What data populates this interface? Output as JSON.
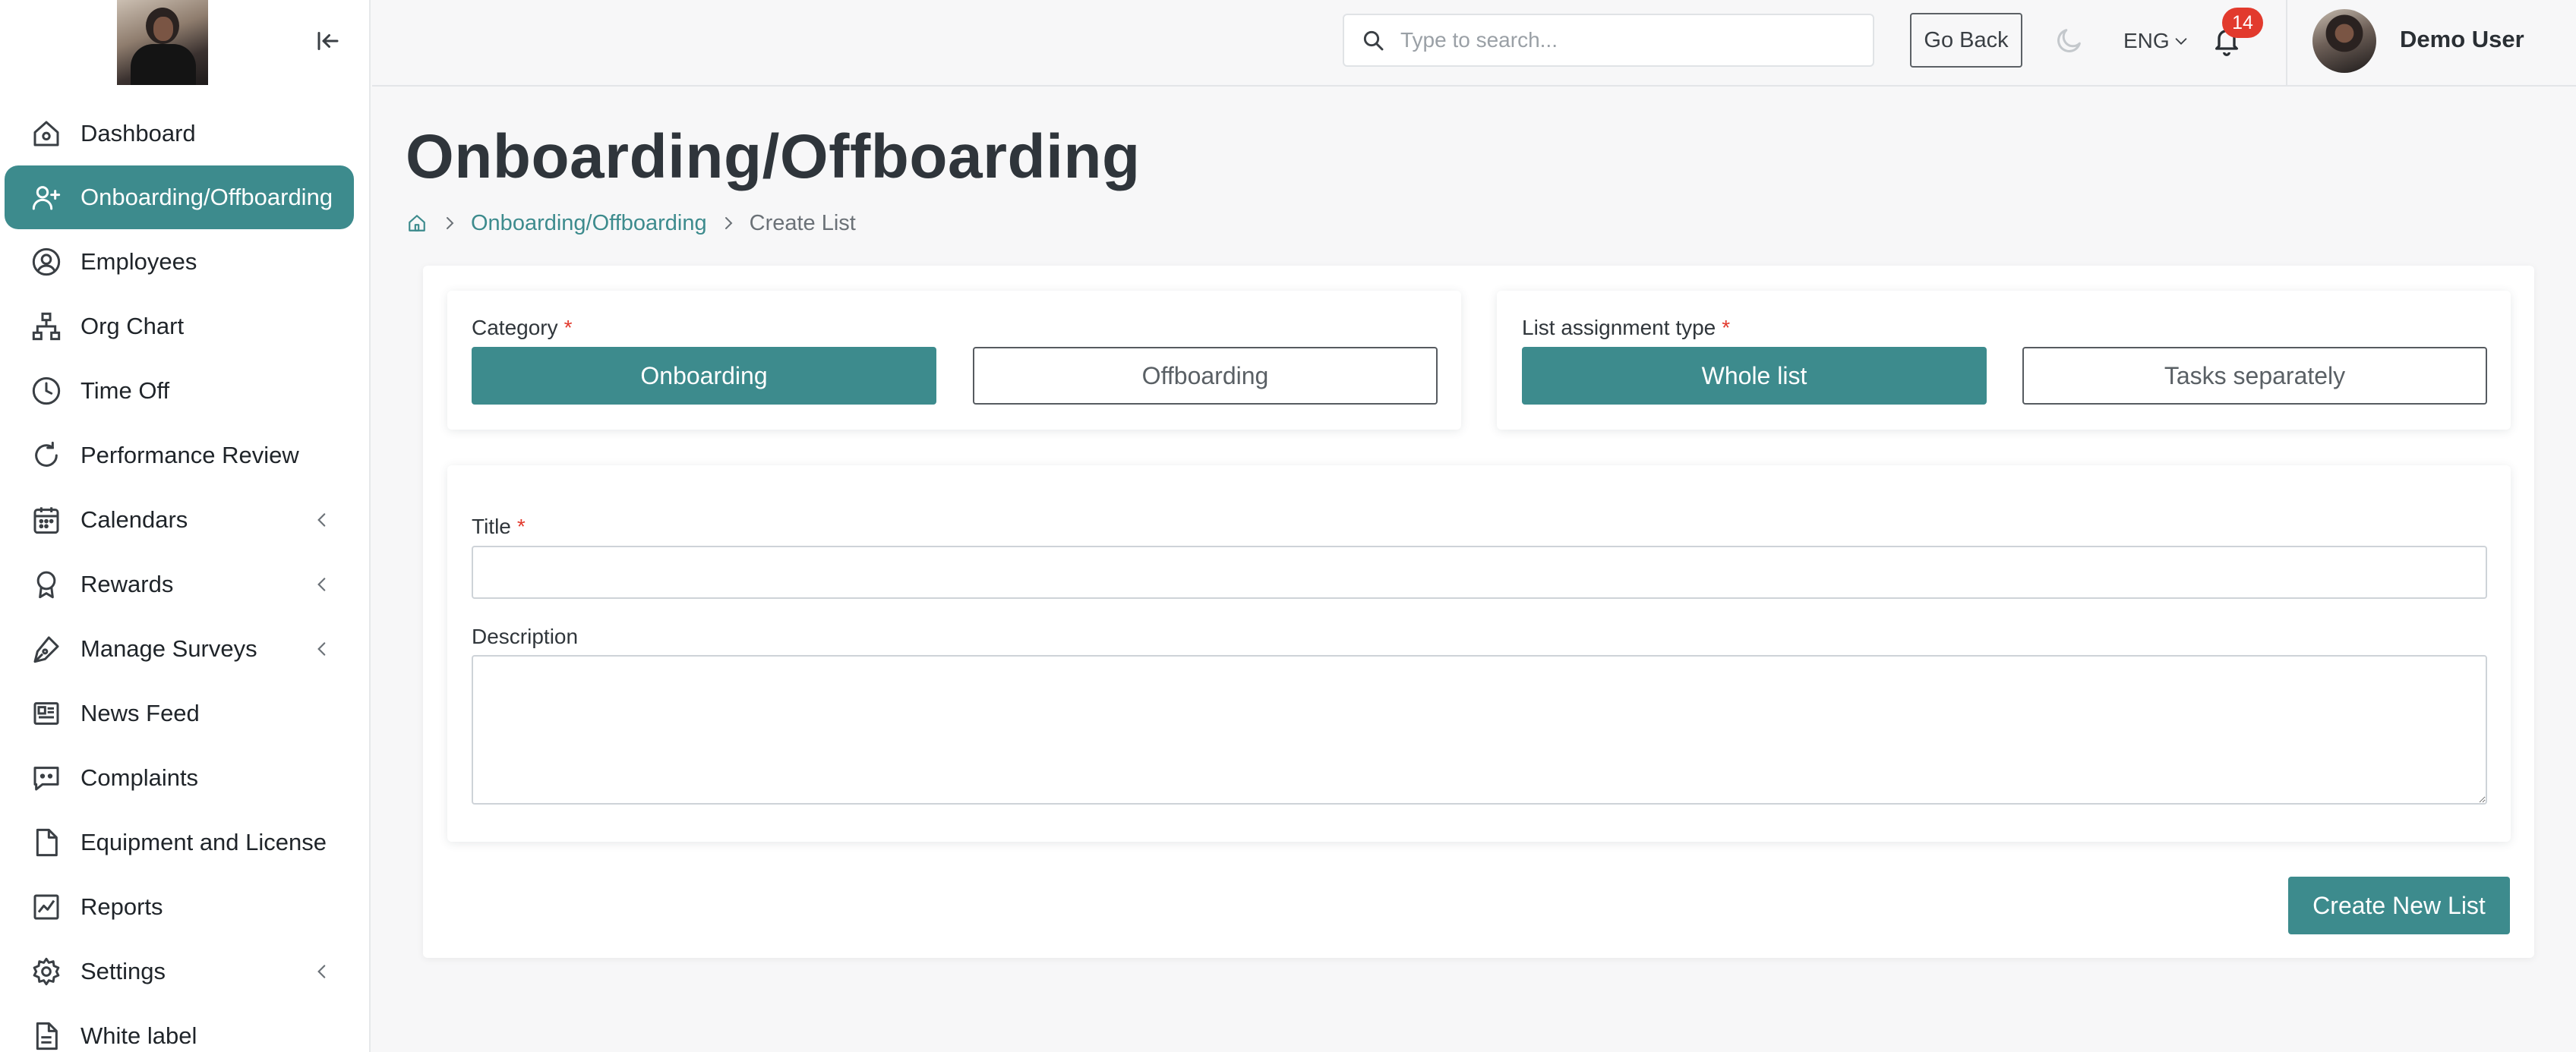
{
  "user": {
    "name": "Demo User"
  },
  "sidebar": {
    "items": [
      {
        "label": "Dashboard",
        "icon": "home-icon",
        "active": false,
        "expandable": false
      },
      {
        "label": "Onboarding/Offboarding",
        "icon": "user-plus-icon",
        "active": true,
        "expandable": false
      },
      {
        "label": "Employees",
        "icon": "user-circle-icon",
        "active": false,
        "expandable": false
      },
      {
        "label": "Org Chart",
        "icon": "org-chart-icon",
        "active": false,
        "expandable": false
      },
      {
        "label": "Time Off",
        "icon": "clock-icon",
        "active": false,
        "expandable": false
      },
      {
        "label": "Performance Review",
        "icon": "refresh-icon",
        "active": false,
        "expandable": false
      },
      {
        "label": "Calendars",
        "icon": "calendar-icon",
        "active": false,
        "expandable": true
      },
      {
        "label": "Rewards",
        "icon": "award-icon",
        "active": false,
        "expandable": true
      },
      {
        "label": "Manage Surveys",
        "icon": "pen-icon",
        "active": false,
        "expandable": true
      },
      {
        "label": "News Feed",
        "icon": "newspaper-icon",
        "active": false,
        "expandable": false
      },
      {
        "label": "Complaints",
        "icon": "message-icon",
        "active": false,
        "expandable": false
      },
      {
        "label": "Equipment and License",
        "icon": "file-icon",
        "active": false,
        "expandable": false
      },
      {
        "label": "Reports",
        "icon": "chart-icon",
        "active": false,
        "expandable": false
      },
      {
        "label": "Settings",
        "icon": "gear-icon",
        "active": false,
        "expandable": true
      },
      {
        "label": "White label",
        "icon": "document-icon",
        "active": false,
        "expandable": false
      }
    ]
  },
  "header": {
    "search_placeholder": "Type to search...",
    "search_value": "",
    "go_back_label": "Go Back",
    "language": "ENG",
    "notification_count": "14"
  },
  "page": {
    "title": "Onboarding/Offboarding",
    "breadcrumb": {
      "parent": "Onboarding/Offboarding",
      "current": "Create List"
    }
  },
  "form": {
    "category": {
      "label": "Category",
      "required_mark": "*",
      "options": [
        "Onboarding",
        "Offboarding"
      ],
      "selected": "Onboarding"
    },
    "assignment": {
      "label": "List assignment type",
      "required_mark": "*",
      "options": [
        "Whole list",
        "Tasks separately"
      ],
      "selected": "Whole list"
    },
    "title": {
      "label": "Title",
      "required_mark": "*",
      "value": ""
    },
    "description": {
      "label": "Description",
      "value": ""
    },
    "submit_label": "Create New List"
  },
  "colors": {
    "accent": "#3d8b8d",
    "badge": "#e23a2d",
    "required": "#e23a2d"
  }
}
